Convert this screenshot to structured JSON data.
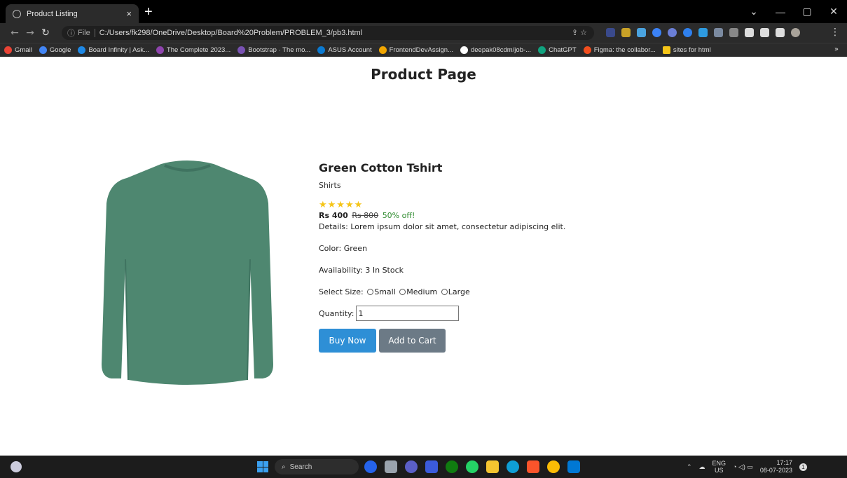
{
  "browser": {
    "tab_title": "Product Listing",
    "tab_close": "×",
    "new_tab": "+",
    "file_label": "File",
    "url": "C:/Users/fk298/OneDrive/Desktop/Board%20Problem/PROBLEM_3/pb3.html",
    "bookmarks": [
      {
        "label": "Gmail",
        "color": "#ea4335"
      },
      {
        "label": "Google",
        "color": "#4285f4"
      },
      {
        "label": "Board Infinity | Ask...",
        "color": "#1e88e5"
      },
      {
        "label": "The Complete 2023...",
        "color": "#8e44ad"
      },
      {
        "label": "Bootstrap · The mo...",
        "color": "#7952b3"
      },
      {
        "label": "ASUS Account",
        "color": "#0b7ad1"
      },
      {
        "label": "FrontendDevAssign...",
        "color": "#f0a500"
      },
      {
        "label": "deepak08cdm/job-...",
        "color": "#ffffff"
      },
      {
        "label": "ChatGPT",
        "color": "#10a37f"
      },
      {
        "label": "Figma: the collabor...",
        "color": "#f24e1e"
      },
      {
        "label": "sites for html",
        "color": "#f5c518"
      }
    ],
    "bookmarks_more": "»"
  },
  "page": {
    "title": "Product Page",
    "product": {
      "name": "Green Cotton Tshirt",
      "category": "Shirts",
      "rating": 5,
      "stars": "★★★★★",
      "price_now": "Rs 400",
      "price_old": "Rs 800",
      "discount": "50% off!",
      "details": "Details: Lorem ipsum dolor sit amet, consectetur adipiscing elit.",
      "color": "Color: Green",
      "availability": "Availability: 3 In Stock",
      "size_label": "Select Size:",
      "sizes": [
        "Small",
        "Medium",
        "Large"
      ],
      "quantity_label": "Quantity:",
      "quantity_value": "1",
      "buy_label": "Buy Now",
      "cart_label": "Add to Cart",
      "shirt_color": "#4e8770"
    }
  },
  "taskbar": {
    "search_label": "Search",
    "lang_top": "ENG",
    "lang_bottom": "US",
    "time": "17:17",
    "date": "08-07-2023",
    "notif_count": "1"
  }
}
